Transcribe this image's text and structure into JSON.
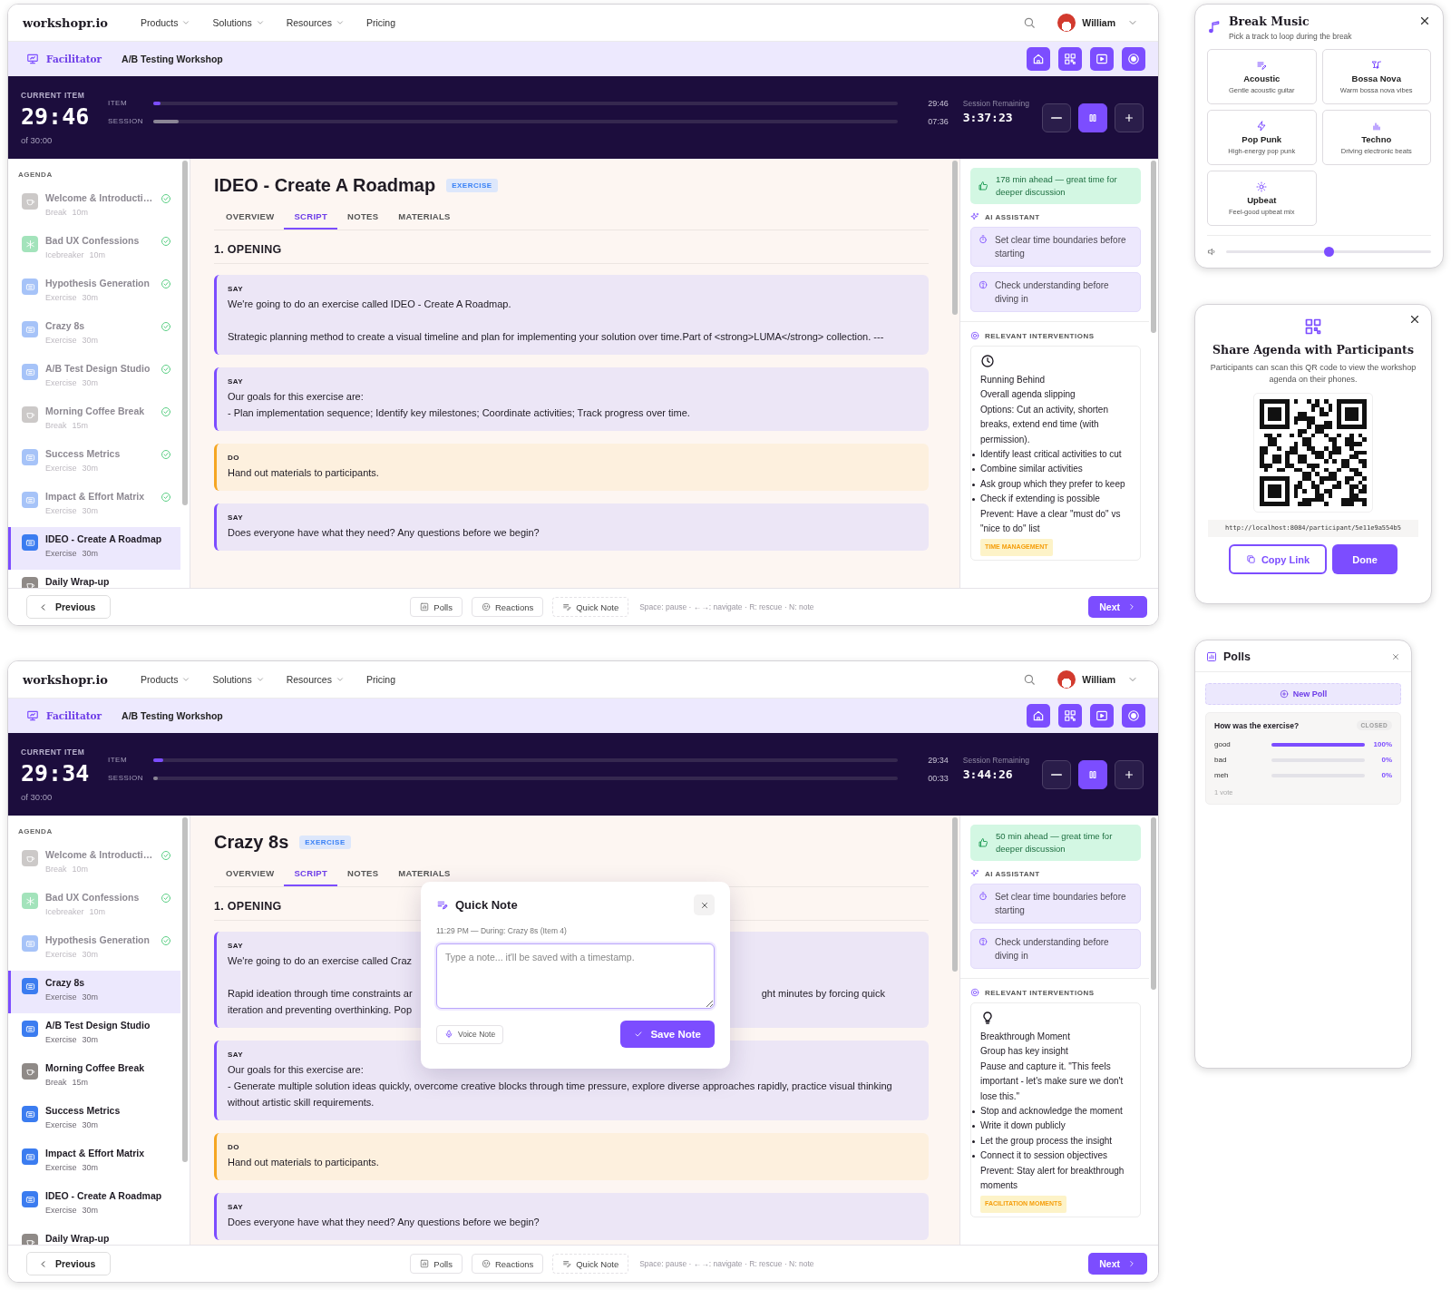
{
  "screens": [
    {
      "nav": {
        "logo": "workshopr.io",
        "menus": [
          {
            "label": "Products",
            "dropdown": true
          },
          {
            "label": "Solutions",
            "dropdown": true
          },
          {
            "label": "Resources",
            "dropdown": true
          },
          {
            "label": "Pricing",
            "dropdown": false
          }
        ],
        "user": "William"
      },
      "toolbar": {
        "role": "Facilitator",
        "workshop": "A/B Testing Workshop",
        "actions": [
          {
            "kind": "home"
          },
          {
            "kind": "qr"
          },
          {
            "kind": "play"
          },
          {
            "kind": "record"
          }
        ]
      },
      "timer": {
        "label": "CURRENT ITEM",
        "time": "29:46",
        "total": "of 30:00",
        "tracks": [
          {
            "label": "ITEM",
            "level": 0.01,
            "time": "29:46"
          },
          {
            "label": "SESSION",
            "level": 0.034,
            "time": "07:36"
          }
        ],
        "remaining_label": "Session Remaining",
        "remaining": "3:37:23"
      },
      "agenda": {
        "heading": "AGENDA",
        "items": [
          {
            "title": "Welcome & Introducti…",
            "kind": "break",
            "type": "Break",
            "duration": "10m",
            "done": true,
            "selected": false
          },
          {
            "title": "Bad UX Confessions",
            "kind": "icebreaker",
            "type": "Icebreaker",
            "duration": "10m",
            "done": true,
            "selected": false
          },
          {
            "title": "Hypothesis Generation",
            "kind": "exercise",
            "type": "Exercise",
            "duration": "30m",
            "done": true,
            "selected": false
          },
          {
            "title": "Crazy 8s",
            "kind": "exercise",
            "type": "Exercise",
            "duration": "30m",
            "done": true,
            "selected": false
          },
          {
            "title": "A/B Test Design Studio",
            "kind": "exercise",
            "type": "Exercise",
            "duration": "30m",
            "done": true,
            "selected": false
          },
          {
            "title": "Morning Coffee Break",
            "kind": "break",
            "type": "Break",
            "duration": "15m",
            "done": true,
            "selected": false
          },
          {
            "title": "Success Metrics",
            "kind": "exercise",
            "type": "Exercise",
            "duration": "30m",
            "done": true,
            "selected": false
          },
          {
            "title": "Impact & Effort Matrix",
            "kind": "exercise",
            "type": "Exercise",
            "duration": "30m",
            "done": true,
            "selected": false
          },
          {
            "title": "IDEO - Create A Roadmap",
            "kind": "exercise",
            "type": "Exercise",
            "duration": "30m",
            "done": false,
            "selected": true
          },
          {
            "title": "Daily Wrap-up",
            "kind": "break",
            "done": false,
            "selected": false
          }
        ]
      },
      "content": {
        "title": "IDEO - Create A Roadmap",
        "badge": "EXERCISE",
        "tabs": [
          {
            "label": "OVERVIEW",
            "selected": false
          },
          {
            "label": "SCRIPT",
            "selected": true
          },
          {
            "label": "NOTES",
            "selected": false
          },
          {
            "label": "MATERIALS",
            "selected": false
          }
        ],
        "section": "1. OPENING",
        "blocks": [
          {
            "kind": "say",
            "label": "SAY",
            "text": "We're going to do an exercise called IDEO - Create A Roadmap.\n\nStrategic planning method to create a visual timeline and plan for implementing your solution over time.Part of <strong>LUMA</strong> collection. ---"
          },
          {
            "kind": "say",
            "label": "SAY",
            "text": "Our goals for this exercise are:\n- Plan implementation sequence; Identify key milestones; Coordinate activities; Track progress over time."
          },
          {
            "kind": "do",
            "label": "DO",
            "text": "Hand out materials to participants."
          },
          {
            "kind": "say",
            "label": "SAY",
            "text": "Does everyone have what they need? Any questions before we begin?"
          }
        ]
      },
      "assistant": {
        "alert": "178 min ahead — great time for deeper discussion",
        "ai_heading": "AI ASSISTANT",
        "tips": [
          {
            "kind": "timer",
            "text": "Set clear time boundaries before starting"
          },
          {
            "kind": "question",
            "text": "Check understanding before diving in"
          }
        ],
        "interventions_heading": "RELEVANT INTERVENTIONS",
        "intervention": {
          "kind": "clock",
          "title": "Running Behind",
          "summary": "Overall agenda slipping",
          "detail": "Options: Cut an activity, shorten breaks, extend end time (with permission).",
          "steps": [
            "Identify least critical activities to cut",
            "Combine similar activities",
            "Ask group which they prefer to keep",
            "Check if extending is possible"
          ],
          "prevent": "Prevent: Have a clear \"must do\" vs \"nice to do\" list",
          "tag": "TIME MANAGEMENT"
        }
      },
      "footer": {
        "previous": "Previous",
        "tools": [
          {
            "kind": "polls",
            "label": "Polls"
          },
          {
            "kind": "reactions",
            "label": "Reactions"
          },
          {
            "kind": "note",
            "label": "Quick Note"
          }
        ],
        "hint": "Space: pause · ←→: navigate · R: rescue · N: note",
        "next": "Next"
      }
    },
    {
      "nav": {
        "logo": "workshopr.io",
        "menus": [
          {
            "label": "Products",
            "dropdown": true
          },
          {
            "label": "Solutions",
            "dropdown": true
          },
          {
            "label": "Resources",
            "dropdown": true
          },
          {
            "label": "Pricing",
            "dropdown": false
          }
        ],
        "user": "William"
      },
      "toolbar": {
        "role": "Facilitator",
        "workshop": "A/B Testing Workshop",
        "actions": [
          {
            "kind": "home"
          },
          {
            "kind": "qr"
          },
          {
            "kind": "play"
          },
          {
            "kind": "record"
          }
        ]
      },
      "timer": {
        "label": "CURRENT ITEM",
        "time": "29:34",
        "total": "of 30:00",
        "tracks": [
          {
            "label": "ITEM",
            "level": 0.013,
            "time": "29:34"
          },
          {
            "label": "SESSION",
            "level": 0.003,
            "time": "00:33"
          }
        ],
        "remaining_label": "Session Remaining",
        "remaining": "3:44:26"
      },
      "agenda": {
        "heading": "AGENDA",
        "items": [
          {
            "title": "Welcome & Introducti…",
            "kind": "break",
            "type": "Break",
            "duration": "10m",
            "done": true,
            "selected": false
          },
          {
            "title": "Bad UX Confessions",
            "kind": "icebreaker",
            "type": "Icebreaker",
            "duration": "10m",
            "done": true,
            "selected": false
          },
          {
            "title": "Hypothesis Generation",
            "kind": "exercise",
            "type": "Exercise",
            "duration": "30m",
            "done": true,
            "selected": false
          },
          {
            "title": "Crazy 8s",
            "kind": "exercise",
            "type": "Exercise",
            "duration": "30m",
            "done": false,
            "selected": true
          },
          {
            "title": "A/B Test Design Studio",
            "kind": "exercise",
            "type": "Exercise",
            "duration": "30m",
            "done": false,
            "selected": false
          },
          {
            "title": "Morning Coffee Break",
            "kind": "break",
            "type": "Break",
            "duration": "15m",
            "done": false,
            "selected": false
          },
          {
            "title": "Success Metrics",
            "kind": "exercise",
            "type": "Exercise",
            "duration": "30m",
            "done": false,
            "selected": false
          },
          {
            "title": "Impact & Effort Matrix",
            "kind": "exercise",
            "type": "Exercise",
            "duration": "30m",
            "done": false,
            "selected": false
          },
          {
            "title": "IDEO - Create A Roadmap",
            "kind": "exercise",
            "type": "Exercise",
            "duration": "30m",
            "done": false,
            "selected": false
          },
          {
            "title": "Daily Wrap-up",
            "kind": "break",
            "done": false,
            "selected": false
          }
        ]
      },
      "content": {
        "title": "Crazy 8s",
        "badge": "EXERCISE",
        "tabs": [
          {
            "label": "OVERVIEW",
            "selected": false
          },
          {
            "label": "SCRIPT",
            "selected": true
          },
          {
            "label": "NOTES",
            "selected": false
          },
          {
            "label": "MATERIALS",
            "selected": false
          }
        ],
        "section": "1. OPENING",
        "blocks": [
          {
            "kind": "say",
            "label": "SAY",
            "paragraphs": [
              {
                "lines": [
                  {
                    "left": "We're going to do an exercise called Craz"
                  }
                ]
              },
              {
                "lines": [
                  {
                    "left": "Rapid ideation through time constraints ar",
                    "right": "ght minutes by forcing quick"
                  },
                  {
                    "left": "iteration and preventing overthinking. Pop"
                  }
                ]
              }
            ]
          },
          {
            "kind": "say",
            "label": "SAY",
            "text": "Our goals for this exercise are:\n- Generate multiple solution ideas quickly, overcome creative blocks through time pressure, explore diverse approaches rapidly, practice visual thinking without artistic skill requirements."
          },
          {
            "kind": "do",
            "label": "DO",
            "text": "Hand out materials to participants."
          },
          {
            "kind": "say",
            "label": "SAY",
            "text": "Does everyone have what they need? Any questions before we begin?"
          }
        ]
      },
      "assistant": {
        "alert": "50 min ahead — great time for deeper discussion",
        "ai_heading": "AI ASSISTANT",
        "tips": [
          {
            "kind": "timer",
            "text": "Set clear time boundaries before starting"
          },
          {
            "kind": "question",
            "text": "Check understanding before diving in"
          }
        ],
        "interventions_heading": "RELEVANT INTERVENTIONS",
        "intervention": {
          "kind": "bulb",
          "title": "Breakthrough Moment",
          "summary": "Group has key insight",
          "detail": "Pause and capture it. \"This feels important - let's make sure we don't lose this.\"",
          "steps": [
            "Stop and acknowledge the moment",
            "Write it down publicly",
            "Let the group process the insight",
            "Connect it to session objectives"
          ],
          "prevent": "Prevent: Stay alert for breakthrough moments",
          "tag": "FACILITATION MOMENTS"
        }
      },
      "footer": {
        "previous": "Previous",
        "tools": [
          {
            "kind": "polls",
            "label": "Polls"
          },
          {
            "kind": "reactions",
            "label": "Reactions"
          },
          {
            "kind": "note",
            "label": "Quick Note"
          }
        ],
        "hint": "Space: pause · ←→: navigate · R: rescue · N: note",
        "next": "Next"
      },
      "quick_note": {
        "title": "Quick Note",
        "meta": "11:29 PM — During: Crazy 8s (Item 4)",
        "placeholder": "Type a note... it'll be saved with a timestamp.",
        "voice": "Voice Note",
        "save": "Save Note"
      }
    }
  ],
  "break_music": {
    "title": "Break Music",
    "subtitle": "Pick a track to loop during the break",
    "tracks": [
      {
        "kind": "note",
        "name": "Acoustic",
        "description": "Gentle acoustic guitar"
      },
      {
        "kind": "bossa",
        "name": "Bossa Nova",
        "description": "Warm bossa nova vibes"
      },
      {
        "kind": "bolt",
        "name": "Pop Punk",
        "description": "High-energy pop punk"
      },
      {
        "kind": "bars",
        "name": "Techno",
        "description": "Driving electronic beats"
      },
      {
        "kind": "sun",
        "name": "Upbeat",
        "description": "Feel-good upbeat mix"
      }
    ],
    "volume": {
      "level": 0.5
    }
  },
  "share_agenda": {
    "title": "Share Agenda with Participants",
    "description": "Participants can scan this QR code to view the workshop agenda on their phones.",
    "url": "http://localhost:8084/participant/5e11e9a554b5",
    "copy": "Copy Link",
    "done": "Done"
  },
  "polls": {
    "title": "Polls",
    "new_poll": "New Poll",
    "poll": {
      "question": "How was the exercise?",
      "status": "CLOSED",
      "options": [
        {
          "label": "good",
          "level": 1,
          "percent": "100%"
        },
        {
          "label": "bad",
          "level": 0,
          "percent": "0%"
        },
        {
          "label": "meh",
          "level": 0,
          "percent": "0%"
        }
      ],
      "votes": "1 vote"
    }
  }
}
